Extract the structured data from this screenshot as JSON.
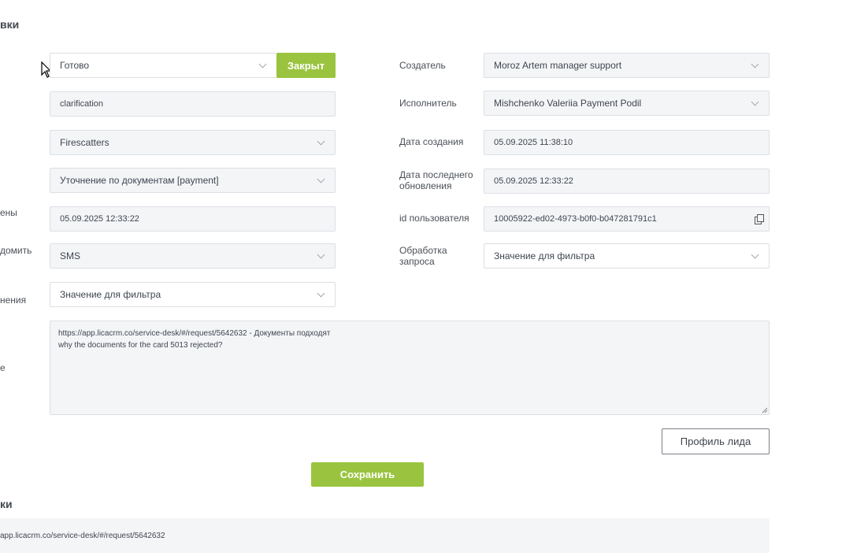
{
  "header": {
    "title_fragment": "вки"
  },
  "status": {
    "value": "Готово",
    "close_button": "Закрыт"
  },
  "tag_field": {
    "value": "clarification"
  },
  "project": {
    "value": "Firescatters"
  },
  "category": {
    "value": "Уточнение по документам [payment]"
  },
  "left_labels": {
    "changed": "ены",
    "notify": "домить",
    "resolution": "нения",
    "comment": "е"
  },
  "changed_date": {
    "value": "05.09.2025 12:33:22"
  },
  "notify_method": {
    "value": "SMS"
  },
  "resolution": {
    "value": "Значение для фильтра"
  },
  "right": {
    "creator_label": "Создатель",
    "creator_value": "Moroz Artem manager support",
    "executor_label": "Исполнитель",
    "executor_value": "Mishchenko Valeriia Payment Podil",
    "created_label": "Дата создания",
    "created_value": "05.09.2025 11:38:10",
    "updated_label_1": "Дата последнего",
    "updated_label_2": "обновления",
    "updated_value": "05.09.2025 12:33:22",
    "user_id_label": "id пользователя",
    "user_id_value": "10005922-ed02-4973-b0f0-b047281791c1",
    "processing_label_1": "Обработка",
    "processing_label_2": "запроса",
    "processing_value": "Значение для фильтра"
  },
  "comment": {
    "line1": "https://app.licacrm.co/service-desk/#/request/5642632 - Документы подходят",
    "line2": "why the documents for the card 5013 rejected?"
  },
  "buttons": {
    "lead_profile": "Профиль лида",
    "save": "Сохранить"
  },
  "bottom": {
    "title_fragment": "ки",
    "link_fragment": "app.licacrm.co/service-desk/#/request/5642632"
  },
  "icons": [
    "chevron-down-icon",
    "copy-icon",
    "mouse-cursor-icon"
  ],
  "colors": {
    "accent_green": "#9ac43f",
    "field_bg": "#f4f5f7",
    "border": "#dcdfe4"
  }
}
